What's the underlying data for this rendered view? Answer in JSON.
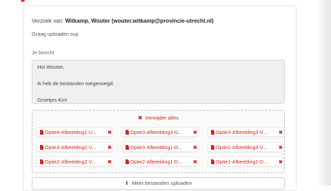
{
  "top": {
    "text": ""
  },
  "request": {
    "prefix": "Verzoek van:",
    "requester": "Witkamp, Wouter (wouter.witkamp@provincie-utrecht.nl)",
    "message": "Graag uploaden svp"
  },
  "reply": {
    "label": "Je bericht",
    "lines": [
      "Hoi Wouter,",
      "",
      "Ik heb de bestanden toegevoegd.",
      "",
      "Groetjes Kim"
    ]
  },
  "dropzone": {
    "remove_all_label": "Verwijder alles",
    "files": [
      "Optie4-Afbeelding1-U...",
      "Optie3-Afbeelding3-G...",
      "Optie3-Afbeelding3-V...",
      "Optie3-Afbeelding2-V...",
      "Optie3-Afbeelding1-O...",
      "Optie2-Afbeelding3-V...",
      "Optie2-Afbeelding2-V...",
      "Optie2-Afbeelding1-D...",
      "Optie1-Afbeelding1-D..."
    ]
  },
  "upload_button": {
    "label": "Meer bestanden uploaden"
  },
  "colors": {
    "accent": "#d0281e",
    "field_bg": "#f0f0f0"
  }
}
